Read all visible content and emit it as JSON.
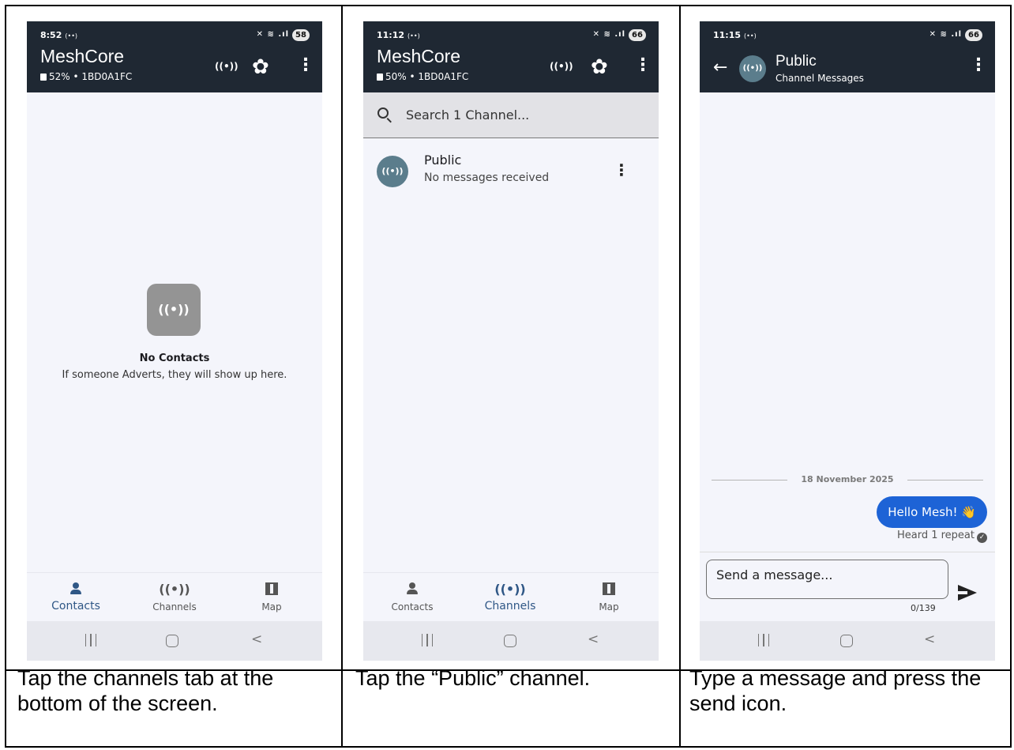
{
  "common": {
    "app_name": "MeshCore",
    "broadcast_glyph": "((•))",
    "gear_glyph": "✿",
    "menu_glyph": "⋮",
    "nav": {
      "contacts": "Contacts",
      "channels": "Channels",
      "map": "Map"
    },
    "sys_back_glyph": "<"
  },
  "panels": [
    {
      "time": "8:52",
      "status_small": "(••)",
      "signal": "✕ ≋ .ıl",
      "battery": "58",
      "subtitle": "52% • 1BD0A1FC",
      "active_tab": "contacts",
      "empty_title": "No Contacts",
      "empty_message": "If someone Adverts, they will show up here.",
      "caption": "Tap the channels tab at the bottom of the screen."
    },
    {
      "time": "11:12",
      "status_small": "(••)",
      "signal": "✕ ≋ .ıl",
      "battery": "66",
      "subtitle": "50% • 1BD0A1FC",
      "active_tab": "channels",
      "search_placeholder": "Search 1 Channel...",
      "channels": [
        {
          "name": "Public",
          "preview": "No messages received"
        }
      ],
      "caption": "Tap the “Public” channel."
    },
    {
      "time": "11:15",
      "status_small": "(••)",
      "signal": "✕ ≋ .ıl",
      "battery": "66",
      "back_glyph": "←",
      "chat_title": "Public",
      "chat_subtitle": "Channel Messages",
      "date_separator": "18 November 2025",
      "message_text": "Hello Mesh!",
      "message_emoji": "👋",
      "delivery_status": "Heard 1 repeat",
      "check_glyph": "✓",
      "input_placeholder": "Send a message...",
      "char_counter": "0/139",
      "caption": "Type a message and press the send icon."
    }
  ],
  "colors": {
    "appbar": "#1f2833",
    "active_tab": "#2f5786",
    "bubble": "#1d63d6",
    "avatar": "#5b7d8c"
  }
}
